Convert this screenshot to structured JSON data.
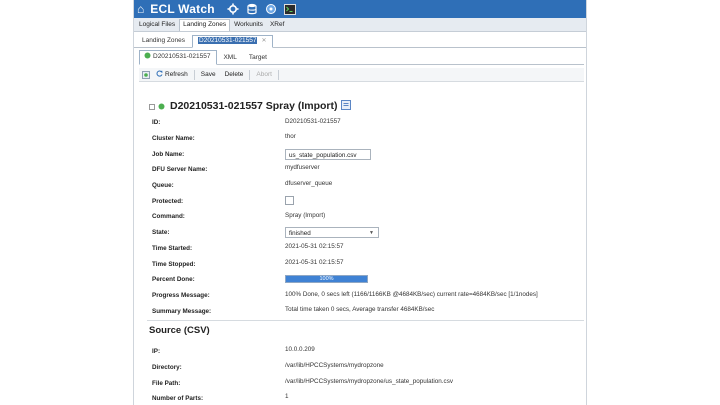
{
  "header": {
    "app_title": "ECL Watch"
  },
  "menu": {
    "items": [
      "Logical Files",
      "Landing Zones",
      "Workunits",
      "XRef"
    ],
    "active": "Landing Zones"
  },
  "top_tabs": {
    "landing_zones": "Landing Zones",
    "workunit": "D20210531-021557"
  },
  "sub_tabs": {
    "summary": "D20210531-021557",
    "xml": "XML",
    "target": "Target"
  },
  "toolbar": {
    "refresh": "Refresh",
    "save": "Save",
    "delete": "Delete",
    "abort": "Abort"
  },
  "page": {
    "title": "D20210531-021557 Spray (Import)"
  },
  "fields": {
    "id": {
      "label": "ID:",
      "value": "D20210531-021557"
    },
    "cluster": {
      "label": "Cluster Name:",
      "value": "thor"
    },
    "job": {
      "label": "Job Name:",
      "value": "us_state_population.csv"
    },
    "dfu_server": {
      "label": "DFU Server Name:",
      "value": "mydfuserver"
    },
    "queue": {
      "label": "Queue:",
      "value": "dfuserver_queue"
    },
    "protected": {
      "label": "Protected:"
    },
    "command": {
      "label": "Command:",
      "value": "Spray (Import)"
    },
    "state": {
      "label": "State:",
      "value": "finished"
    },
    "time_started": {
      "label": "Time Started:",
      "value": "2021-05-31 02:15:57"
    },
    "time_stopped": {
      "label": "Time Stopped:",
      "value": "2021-05-31 02:15:57"
    },
    "percent_done": {
      "label": "Percent Done:",
      "value": "100%",
      "fraction": 1.0
    },
    "progress_message": {
      "label": "Progress Message:",
      "value": "100% Done, 0 secs left (1166/1166KB @4684KB/sec) current rate=4684KB/sec [1/1nodes]"
    },
    "summary_message": {
      "label": "Summary Message:",
      "value": "Total time taken 0 secs, Average transfer 4684KB/sec"
    }
  },
  "source": {
    "title": "Source (CSV)",
    "ip": {
      "label": "IP:",
      "value": "10.0.0.209"
    },
    "directory": {
      "label": "Directory:",
      "value": "/var/lib/HPCCSystems/mydropzone"
    },
    "file_path": {
      "label": "File Path:",
      "value": "/var/lib/HPCCSystems/mydropzone/us_state_population.csv"
    },
    "num_parts": {
      "label": "Number of Parts:",
      "value": "1"
    }
  },
  "colors": {
    "brand": "#2f6fb7",
    "progress": "#3f82d4",
    "status_ok": "#4caf50"
  }
}
